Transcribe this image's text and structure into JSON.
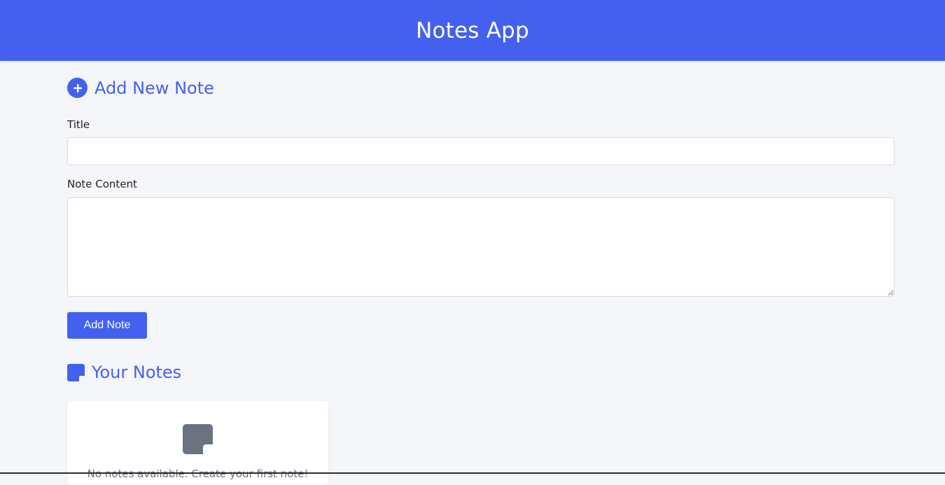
{
  "header": {
    "title": "Notes App"
  },
  "add_section": {
    "title": "Add New Note",
    "icon": "plus-circle-icon"
  },
  "form": {
    "title_label": "Title",
    "title_value": "",
    "content_label": "Note Content",
    "content_value": "",
    "submit_label": "Add Note"
  },
  "notes_section": {
    "title": "Your Notes",
    "icon": "sticky-note-icon",
    "empty_message": "No notes available. Create your first note!",
    "empty_icon": "sticky-note-icon"
  },
  "colors": {
    "accent": "#4361ee",
    "background": "#f5f6fa",
    "muted_icon": "#6b7280"
  }
}
